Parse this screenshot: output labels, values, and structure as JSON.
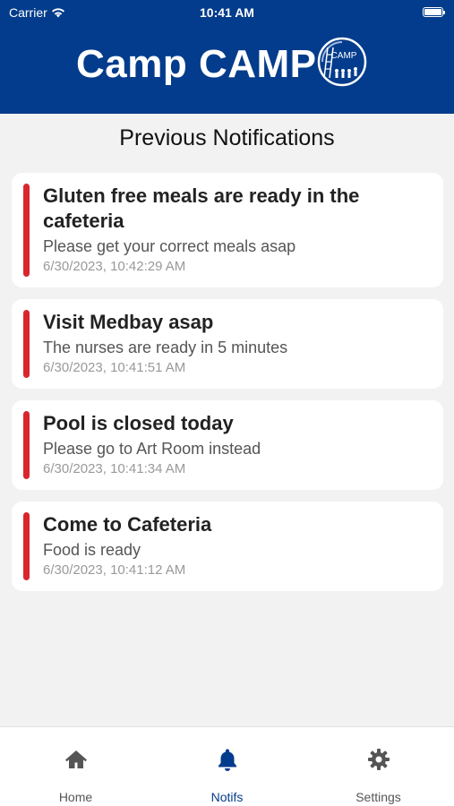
{
  "status": {
    "carrier": "Carrier",
    "time": "10:41 AM"
  },
  "header": {
    "title": "Camp CAMP",
    "logo_text": "CAMP"
  },
  "page": {
    "title": "Previous Notifications"
  },
  "notifications": [
    {
      "title": "Gluten free meals are ready in the cafeteria",
      "body": "Please get your correct meals asap",
      "date": "6/30/2023, 10:42:29 AM"
    },
    {
      "title": "Visit Medbay asap",
      "body": "The nurses are ready in 5 minutes",
      "date": "6/30/2023, 10:41:51 AM"
    },
    {
      "title": "Pool is closed today",
      "body": "Please go to Art Room instead",
      "date": "6/30/2023, 10:41:34 AM"
    },
    {
      "title": "Come to Cafeteria",
      "body": "Food is ready",
      "date": "6/30/2023, 10:41:12 AM"
    }
  ],
  "tabs": [
    {
      "label": "Home",
      "icon": "home-icon"
    },
    {
      "label": "Notifs",
      "icon": "bell-icon",
      "active": true
    },
    {
      "label": "Settings",
      "icon": "gear-icon"
    }
  ],
  "colors": {
    "header": "#033c8c",
    "accent_bar": "#d9262e",
    "active_tab": "#033c8c"
  }
}
